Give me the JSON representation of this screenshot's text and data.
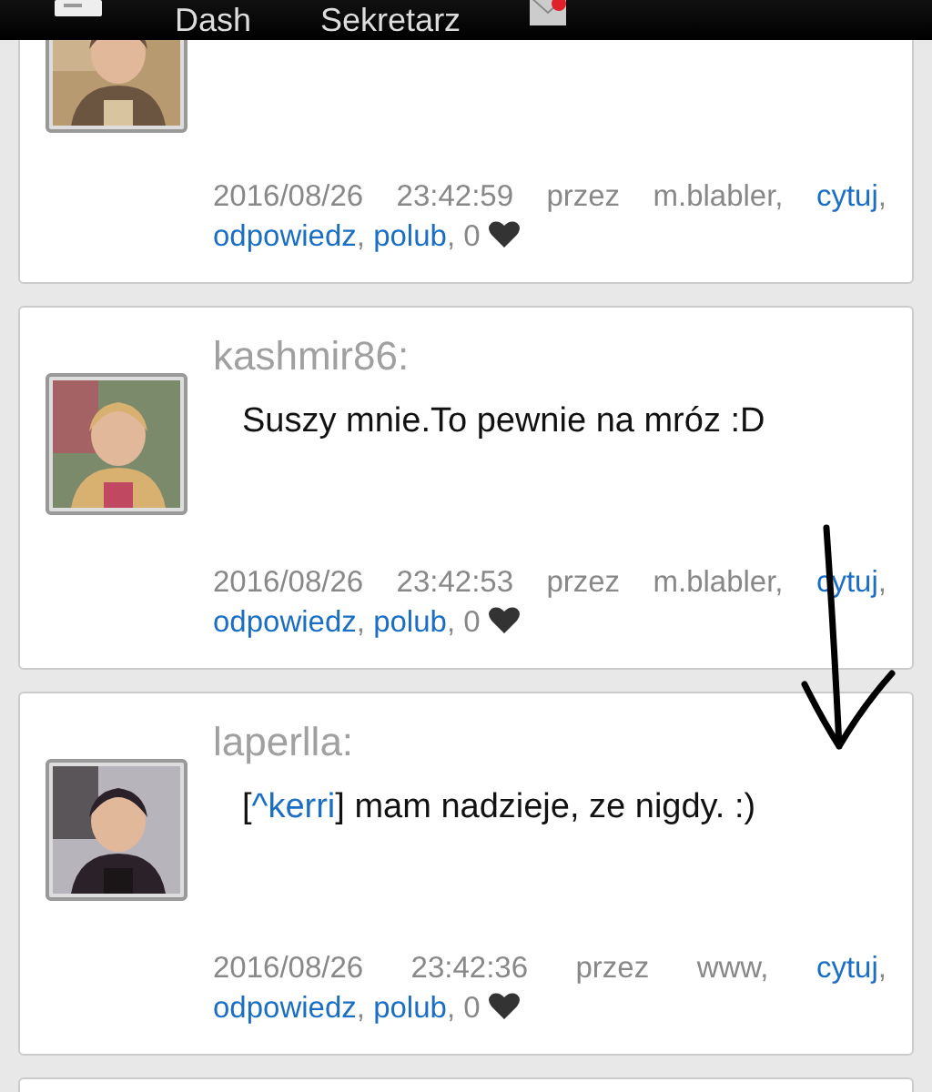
{
  "nav": {
    "items": [
      {
        "kind": "menu"
      },
      {
        "kind": "text",
        "label": "Dash"
      },
      {
        "kind": "text",
        "label": "Sekretarz"
      },
      {
        "kind": "mail",
        "unread": true
      }
    ]
  },
  "posts": [
    {
      "timestamp": "2016/08/26 23:42:59",
      "by": "przez m.blabler,",
      "links": [
        {
          "label": "cytuj",
          "after": ","
        },
        {
          "label": "odpowiedz",
          "after": ","
        },
        {
          "label": "polub",
          "after": ", 0"
        }
      ]
    },
    {
      "author": "kashmir86:",
      "message": {
        "text": "Suszy mnie.To pewnie na mróz :D"
      },
      "timestamp": "2016/08/26 23:42:53",
      "by": "przez m.blabler,",
      "links": [
        {
          "label": "cytuj",
          "after": ","
        },
        {
          "label": "odpowiedz",
          "after": ","
        },
        {
          "label": "polub",
          "after": ", 0"
        }
      ]
    },
    {
      "author": "laperlla:",
      "message": {
        "before": "[",
        "mention": "^kerri",
        "after": "] mam nadzieje, ze nigdy. :)"
      },
      "timestamp": "2016/08/26 23:42:36",
      "by": "przez www,",
      "links": [
        {
          "label": "cytuj",
          "after": ","
        },
        {
          "label": "odpowiedz",
          "after": ","
        },
        {
          "label": "polub",
          "after": ", 0"
        }
      ]
    }
  ]
}
